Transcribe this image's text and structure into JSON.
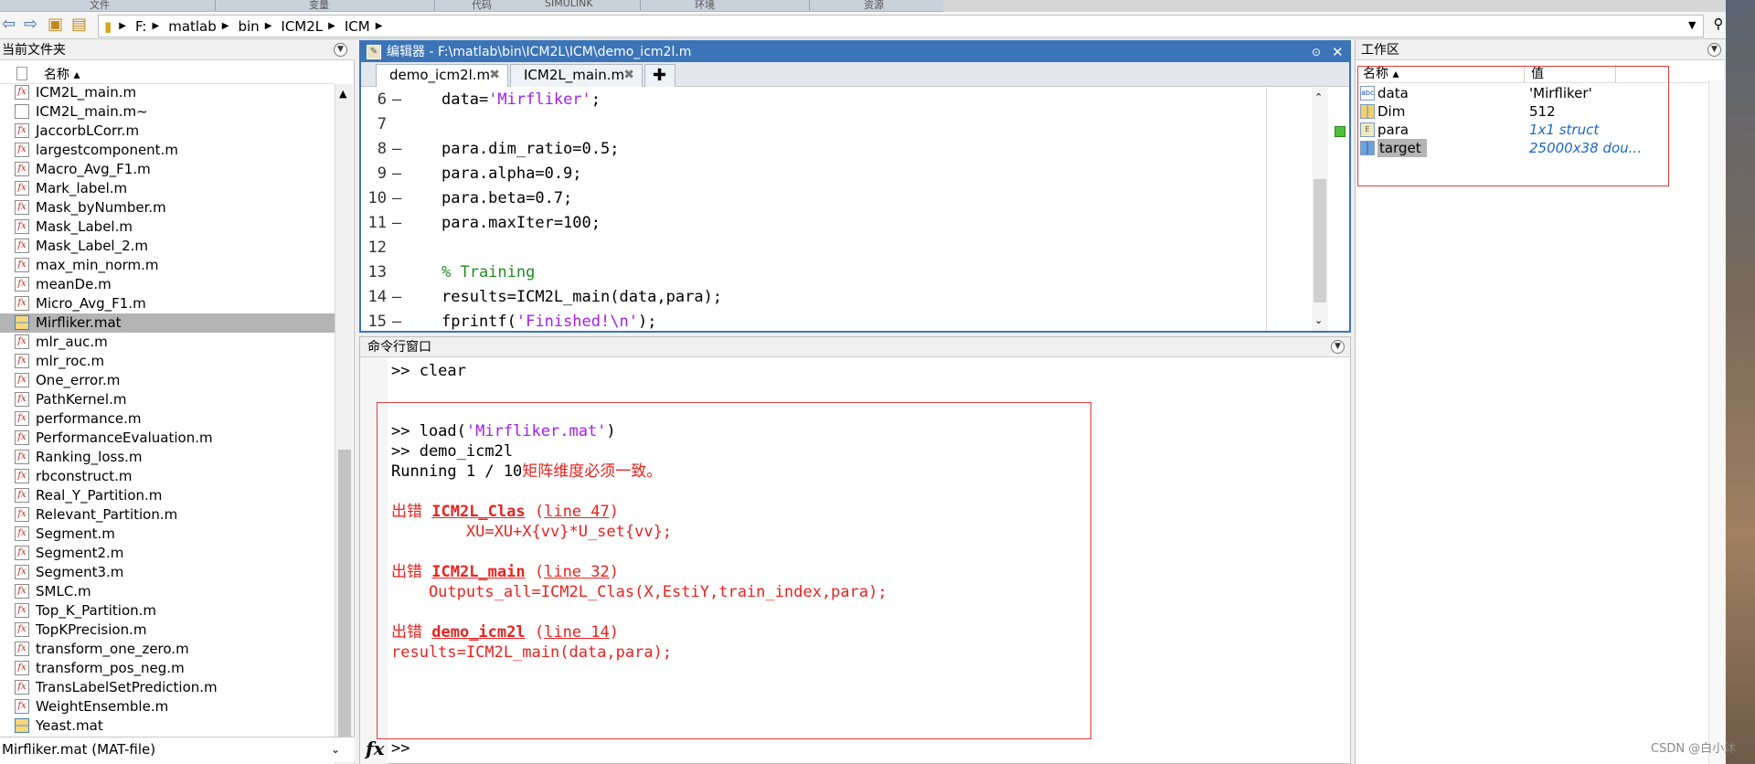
{
  "ribbon": {
    "tabs": [
      "文件",
      "变量",
      "代码",
      "SIMULINK",
      "环境",
      "资源"
    ]
  },
  "address": {
    "segments": [
      "F:",
      "matlab",
      "bin",
      "ICM2L",
      "ICM"
    ]
  },
  "file_browser": {
    "title": "当前文件夹",
    "column": "名称 ▴",
    "files": [
      {
        "name": "ICM2L_main.m",
        "kind": "m"
      },
      {
        "name": "ICM2L_main.m~",
        "kind": "plain"
      },
      {
        "name": "JaccorbLCorr.m",
        "kind": "m"
      },
      {
        "name": "largestcomponent.m",
        "kind": "m"
      },
      {
        "name": "Macro_Avg_F1.m",
        "kind": "m"
      },
      {
        "name": "Mark_label.m",
        "kind": "m"
      },
      {
        "name": "Mask_byNumber.m",
        "kind": "m"
      },
      {
        "name": "Mask_Label.m",
        "kind": "m"
      },
      {
        "name": "Mask_Label_2.m",
        "kind": "m"
      },
      {
        "name": "max_min_norm.m",
        "kind": "m"
      },
      {
        "name": "meanDe.m",
        "kind": "m"
      },
      {
        "name": "Micro_Avg_F1.m",
        "kind": "m"
      },
      {
        "name": "Mirfliker.mat",
        "kind": "mat",
        "selected": true
      },
      {
        "name": "mlr_auc.m",
        "kind": "m"
      },
      {
        "name": "mlr_roc.m",
        "kind": "m"
      },
      {
        "name": "One_error.m",
        "kind": "m"
      },
      {
        "name": "PathKernel.m",
        "kind": "m"
      },
      {
        "name": "performance.m",
        "kind": "m"
      },
      {
        "name": "PerformanceEvaluation.m",
        "kind": "m"
      },
      {
        "name": "Ranking_loss.m",
        "kind": "m"
      },
      {
        "name": "rbconstruct.m",
        "kind": "m"
      },
      {
        "name": "Real_Y_Partition.m",
        "kind": "m"
      },
      {
        "name": "Relevant_Partition.m",
        "kind": "m"
      },
      {
        "name": "Segment.m",
        "kind": "m"
      },
      {
        "name": "Segment2.m",
        "kind": "m"
      },
      {
        "name": "Segment3.m",
        "kind": "m"
      },
      {
        "name": "SMLC.m",
        "kind": "m"
      },
      {
        "name": "Top_K_Partition.m",
        "kind": "m"
      },
      {
        "name": "TopKPrecision.m",
        "kind": "m"
      },
      {
        "name": "transform_one_zero.m",
        "kind": "m"
      },
      {
        "name": "transform_pos_neg.m",
        "kind": "m"
      },
      {
        "name": "TransLabelSetPrediction.m",
        "kind": "m"
      },
      {
        "name": "WeightEnsemble.m",
        "kind": "m"
      },
      {
        "name": "Yeast.mat",
        "kind": "mat"
      }
    ],
    "status": "Mirfliker.mat  (MAT-file)"
  },
  "editor": {
    "title": "编辑器 - F:\\matlab\\bin\\ICM2L\\ICM\\demo_icm2l.m",
    "tabs": [
      "demo_icm2l.m",
      "ICM2L_main.m"
    ],
    "lines": [
      {
        "n": "6",
        "dash": true,
        "parts": [
          [
            "",
            "data="
          ],
          [
            "str",
            "'Mirfliker'"
          ],
          [
            "",
            ";"
          ]
        ]
      },
      {
        "n": "7",
        "dash": false,
        "parts": []
      },
      {
        "n": "8",
        "dash": true,
        "parts": [
          [
            "",
            "para.dim_ratio=0.5;"
          ]
        ]
      },
      {
        "n": "9",
        "dash": true,
        "parts": [
          [
            "",
            "para.alpha=0.9;"
          ]
        ]
      },
      {
        "n": "10",
        "dash": true,
        "parts": [
          [
            "",
            "para.beta=0.7;"
          ]
        ]
      },
      {
        "n": "11",
        "dash": true,
        "parts": [
          [
            "",
            "para.maxIter=100;"
          ]
        ]
      },
      {
        "n": "12",
        "dash": false,
        "parts": []
      },
      {
        "n": "13",
        "dash": false,
        "parts": [
          [
            "cmt",
            "% Training"
          ]
        ]
      },
      {
        "n": "14",
        "dash": true,
        "parts": [
          [
            "",
            "results=ICM2L_main(data,para);"
          ]
        ]
      },
      {
        "n": "15",
        "dash": true,
        "parts": [
          [
            "",
            "fprintf("
          ],
          [
            "str",
            "'Finished!\\n'"
          ],
          [
            "",
            ");"
          ]
        ]
      }
    ]
  },
  "command": {
    "title": "命令行窗口",
    "lines": [
      {
        "parts": [
          [
            "",
            ">> clear"
          ]
        ]
      },
      {
        "parts": []
      },
      {
        "parts": [
          [
            "",
            ">> load("
          ],
          [
            "str",
            "'Mirfliker.mat'"
          ],
          [
            "",
            ")"
          ]
        ]
      },
      {
        "parts": [
          [
            "",
            ">> demo_icm2l"
          ]
        ]
      },
      {
        "parts": [
          [
            "",
            "Running 1 / 10"
          ],
          [
            "err",
            "矩阵维度必须一致。"
          ]
        ]
      },
      {
        "parts": []
      },
      {
        "parts": [
          [
            "err",
            "出错 "
          ],
          [
            "errlink",
            "ICM2L_Clas"
          ],
          [
            "err",
            " ("
          ],
          [
            "lnlink",
            "line 47"
          ],
          [
            "err",
            ")"
          ]
        ]
      },
      {
        "parts": [
          [
            "err",
            "        XU=XU+X{vv}*U_set{vv};"
          ]
        ]
      },
      {
        "parts": []
      },
      {
        "parts": [
          [
            "err",
            "出错 "
          ],
          [
            "errlink",
            "ICM2L_main"
          ],
          [
            "err",
            " ("
          ],
          [
            "lnlink",
            "line 32"
          ],
          [
            "err",
            ")"
          ]
        ]
      },
      {
        "parts": [
          [
            "err",
            "    Outputs_all=ICM2L_Clas(X,EstiY,train_index,para);"
          ]
        ]
      },
      {
        "parts": []
      },
      {
        "parts": [
          [
            "err",
            "出错 "
          ],
          [
            "errlink",
            "demo_icm2l"
          ],
          [
            "err",
            " ("
          ],
          [
            "lnlink",
            "line 14"
          ],
          [
            "err",
            ")"
          ]
        ]
      },
      {
        "parts": [
          [
            "err",
            "results=ICM2L_main(data,para);"
          ]
        ]
      }
    ],
    "prompt": ">>",
    "fx": "fx"
  },
  "workspace": {
    "title": "工作区",
    "col_name": "名称 ▴",
    "col_value": "值",
    "vars": [
      {
        "name": "data",
        "value": "'Mirfliker'",
        "icon": "abc",
        "italic": false,
        "selected": false
      },
      {
        "name": "Dim",
        "value": "512",
        "icon": "grid",
        "italic": false,
        "selected": false
      },
      {
        "name": "para",
        "value": "1x1 struct",
        "icon": "struct",
        "italic": true,
        "selected": false
      },
      {
        "name": "target",
        "value": "25000x38 dou...",
        "icon": "gridblue",
        "italic": true,
        "selected": true
      }
    ]
  },
  "watermark": "CSDN @白小沐"
}
